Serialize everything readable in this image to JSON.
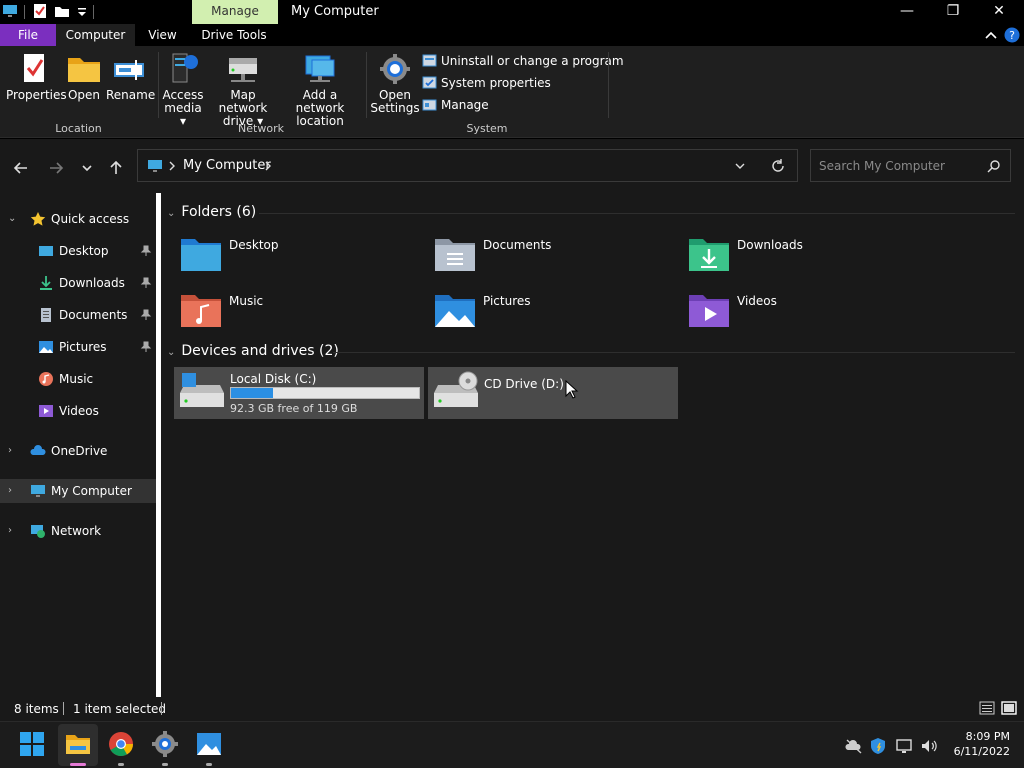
{
  "window": {
    "title": "My Computer",
    "context_tab": "Manage",
    "minimize": "—",
    "maximize": "❐",
    "close": "✕"
  },
  "ribbon_tabs": {
    "file": "File",
    "computer": "Computer",
    "view": "View",
    "drive_tools": "Drive Tools"
  },
  "ribbon": {
    "location": {
      "label": "Location",
      "properties": "Properties",
      "open": "Open",
      "rename": "Rename"
    },
    "network": {
      "label": "Network",
      "access_media_1": "Access",
      "access_media_2": "media ▾",
      "map_drive_1": "Map network",
      "map_drive_2": "drive ▾",
      "add_location_1": "Add a network",
      "add_location_2": "location"
    },
    "system": {
      "label": "System",
      "open_settings_1": "Open",
      "open_settings_2": "Settings",
      "uninstall": "Uninstall or change a program",
      "system_properties": "System properties",
      "manage": "Manage"
    }
  },
  "address": {
    "crumb": "My Computer",
    "search_placeholder": "Search My Computer"
  },
  "nav_pane": {
    "quick_access": "Quick access",
    "desktop": "Desktop",
    "downloads": "Downloads",
    "documents": "Documents",
    "pictures": "Pictures",
    "music": "Music",
    "videos": "Videos",
    "onedrive": "OneDrive",
    "my_computer": "My Computer",
    "network": "Network"
  },
  "content": {
    "folders_header": "Folders (6)",
    "folders": [
      "Desktop",
      "Documents",
      "Downloads",
      "Music",
      "Pictures",
      "Videos"
    ],
    "devices_header": "Devices and drives (2)",
    "drives": [
      {
        "name": "Local Disk (C:)",
        "free": "92.3 GB free of 119 GB",
        "used_fraction": 0.224
      },
      {
        "name": "CD Drive (D:)"
      }
    ]
  },
  "status": {
    "items": "8 items",
    "selected": "1 item selected"
  },
  "clock": {
    "time": "8:09 PM",
    "date": "6/11/2022"
  },
  "colors": {
    "file_tab": "#7b2fbf",
    "context_tab": "#d2efb0",
    "drive_fill": "#2b8fe3",
    "selected_bg": "#333333"
  }
}
